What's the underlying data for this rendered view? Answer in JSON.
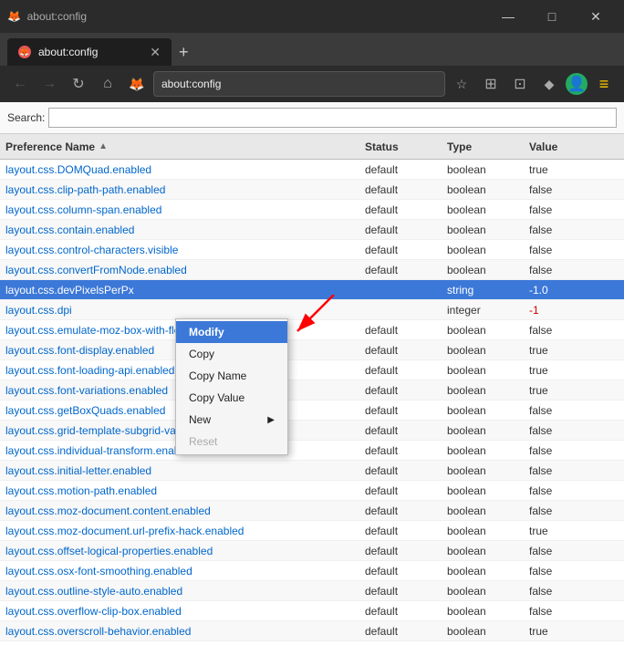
{
  "window": {
    "title": "about:config",
    "controls": {
      "minimize": "—",
      "maximize": "□",
      "close": "✕"
    }
  },
  "tab": {
    "favicon": "🦊",
    "title": "about:config",
    "close": "✕"
  },
  "new_tab_btn": "+",
  "nav": {
    "back": "←",
    "forward": "→",
    "reload": "↻",
    "home": "⌂",
    "firefox_label": "Firefox",
    "url": "about:config",
    "bookmark": "☆",
    "library": "|||",
    "sync": "⊞",
    "shield": "◆",
    "avatar": "👤",
    "menu": "≡"
  },
  "search": {
    "label": "Search:",
    "placeholder": ""
  },
  "table": {
    "headers": [
      "Preference Name",
      "Status",
      "Type",
      "Value",
      ""
    ],
    "rows": [
      {
        "name": "layout.css.DOMQuad.enabled",
        "status": "default",
        "type": "boolean",
        "value": "true",
        "selected": false
      },
      {
        "name": "layout.css.clip-path-path.enabled",
        "status": "default",
        "type": "boolean",
        "value": "false",
        "selected": false
      },
      {
        "name": "layout.css.column-span.enabled",
        "status": "default",
        "type": "boolean",
        "value": "false",
        "selected": false
      },
      {
        "name": "layout.css.contain.enabled",
        "status": "default",
        "type": "boolean",
        "value": "false",
        "selected": false
      },
      {
        "name": "layout.css.control-characters.visible",
        "status": "default",
        "type": "boolean",
        "value": "false",
        "selected": false
      },
      {
        "name": "layout.css.convertFromNode.enabled",
        "status": "default",
        "type": "boolean",
        "value": "false",
        "selected": false
      },
      {
        "name": "layout.css.devPixelsPerPx",
        "status": "",
        "type": "string",
        "value": "-1.0",
        "selected": true
      },
      {
        "name": "layout.css.dpi",
        "status": "",
        "type": "integer",
        "value": "-1",
        "selected": false
      },
      {
        "name": "layout.css.emulate-moz-box-with-flex",
        "status": "default",
        "type": "boolean",
        "value": "false",
        "selected": false
      },
      {
        "name": "layout.css.font-display.enabled",
        "status": "default",
        "type": "boolean",
        "value": "true",
        "selected": false
      },
      {
        "name": "layout.css.font-loading-api.enabled",
        "status": "default",
        "type": "boolean",
        "value": "true",
        "selected": false
      },
      {
        "name": "layout.css.font-variations.enabled",
        "status": "default",
        "type": "boolean",
        "value": "true",
        "selected": false
      },
      {
        "name": "layout.css.getBoxQuads.enabled",
        "status": "default",
        "type": "boolean",
        "value": "false",
        "selected": false
      },
      {
        "name": "layout.css.grid-template-subgrid-value.enabled",
        "status": "default",
        "type": "boolean",
        "value": "false",
        "selected": false
      },
      {
        "name": "layout.css.individual-transform.enabled",
        "status": "default",
        "type": "boolean",
        "value": "false",
        "selected": false
      },
      {
        "name": "layout.css.initial-letter.enabled",
        "status": "default",
        "type": "boolean",
        "value": "false",
        "selected": false
      },
      {
        "name": "layout.css.motion-path.enabled",
        "status": "default",
        "type": "boolean",
        "value": "false",
        "selected": false
      },
      {
        "name": "layout.css.moz-document.content.enabled",
        "status": "default",
        "type": "boolean",
        "value": "false",
        "selected": false
      },
      {
        "name": "layout.css.moz-document.url-prefix-hack.enabled",
        "status": "default",
        "type": "boolean",
        "value": "true",
        "selected": false
      },
      {
        "name": "layout.css.offset-logical-properties.enabled",
        "status": "default",
        "type": "boolean",
        "value": "false",
        "selected": false
      },
      {
        "name": "layout.css.osx-font-smoothing.enabled",
        "status": "default",
        "type": "boolean",
        "value": "false",
        "selected": false
      },
      {
        "name": "layout.css.outline-style-auto.enabled",
        "status": "default",
        "type": "boolean",
        "value": "false",
        "selected": false
      },
      {
        "name": "layout.css.overflow-clip-box.enabled",
        "status": "default",
        "type": "boolean",
        "value": "false",
        "selected": false
      },
      {
        "name": "layout.css.overscroll-behavior.enabled",
        "status": "default",
        "type": "boolean",
        "value": "true",
        "selected": false
      }
    ]
  },
  "context_menu": {
    "items": [
      {
        "label": "Modify",
        "active": true,
        "disabled": false,
        "has_arrow": false
      },
      {
        "label": "Copy",
        "active": false,
        "disabled": false,
        "has_arrow": false
      },
      {
        "label": "Copy Name",
        "active": false,
        "disabled": false,
        "has_arrow": false
      },
      {
        "label": "Copy Value",
        "active": false,
        "disabled": false,
        "has_arrow": false
      },
      {
        "label": "New",
        "active": false,
        "disabled": false,
        "has_arrow": true
      },
      {
        "label": "Reset",
        "active": false,
        "disabled": true,
        "has_arrow": false
      }
    ]
  }
}
